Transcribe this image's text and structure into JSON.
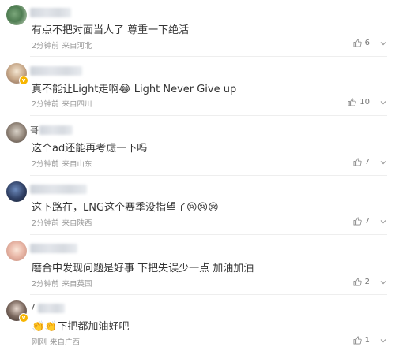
{
  "comments": [
    {
      "user_hint": "",
      "text": "有点不把对面当人了 尊重一下绝活",
      "time": "2分钟前",
      "location": "来自河北",
      "likes": "6"
    },
    {
      "user_hint": "",
      "text": "真不能让Light走啊😂 Light Never Give up",
      "time": "2分钟前",
      "location": "来自四川",
      "likes": "10"
    },
    {
      "user_hint": "哥",
      "text": "这个ad还能再考虑一下吗",
      "time": "2分钟前",
      "location": "来自山东",
      "likes": "7"
    },
    {
      "user_hint": "",
      "text": "这下路在，LNG这个赛季没指望了😢😢😢",
      "time": "2分钟前",
      "location": "来自陕西",
      "likes": "7"
    },
    {
      "user_hint": "",
      "text": "磨合中发现问题是好事 下把失误少一点 加油加油",
      "time": "2分钟前",
      "location": "来自英国",
      "likes": "2"
    },
    {
      "user_hint": "7",
      "text": "👏👏下把都加油好吧",
      "time": "刚刚",
      "location": "来自广西",
      "likes": "1"
    }
  ],
  "icons": {
    "like": "thumbs-up-icon",
    "more": "chevron-down-icon",
    "verify": "verified-badge-icon"
  },
  "colors": {
    "text": "#333333",
    "meta": "#999999",
    "verify": "#f7b500"
  }
}
